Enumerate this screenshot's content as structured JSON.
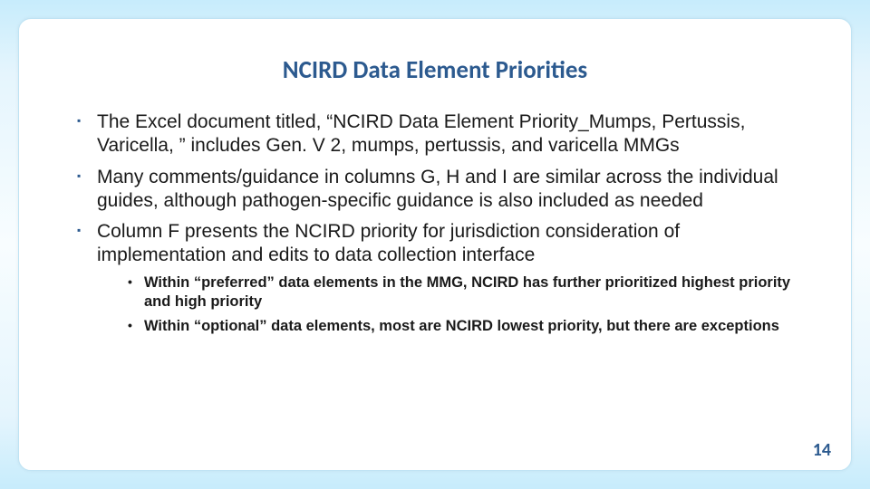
{
  "title": "NCIRD Data Element Priorities",
  "bullets": {
    "b1": "The Excel document titled, “NCIRD Data Element Priority_Mumps, Pertussis, Varicella, ” includes Gen. V 2, mumps, pertussis, and varicella MMGs",
    "b2": "Many comments/guidance in columns G, H and I are similar across the individual guides, although pathogen-specific guidance is also included as needed",
    "b3": "Column F presents the NCIRD priority for jurisdiction consideration of implementation and edits to data collection interface",
    "sub1": "Within “preferred” data elements in the MMG, NCIRD has further prioritized highest priority and high priority",
    "sub2": "Within “optional” data elements, most are NCIRD lowest priority, but there are exceptions"
  },
  "page_number": "14"
}
